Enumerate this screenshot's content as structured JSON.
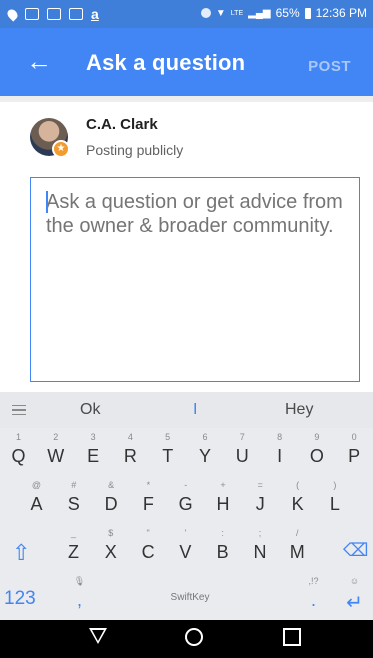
{
  "status_bar": {
    "left_icons": [
      "location-icon",
      "keyboard-icon",
      "image-icon",
      "mail-icon",
      "amazon-icon"
    ],
    "right_icons": [
      "bluetooth-icon",
      "wifi-icon",
      "lte-icon",
      "signal-icon"
    ],
    "network_label": "LTE",
    "battery": "65%",
    "time": "12:36 PM"
  },
  "app_bar": {
    "back_icon": "arrow-left-icon",
    "title": "Ask a question",
    "post_label": "POST"
  },
  "user": {
    "name": "C.A. Clark",
    "visibility": "Posting publicly",
    "badge_icon": "star-badge-icon"
  },
  "question": {
    "placeholder": "Ask a question or get advice from the owner & broader community.",
    "value": ""
  },
  "keyboard": {
    "suggestions": [
      "Ok",
      "I",
      "Hey"
    ],
    "row1": [
      {
        "h": "1",
        "m": "Q"
      },
      {
        "h": "2",
        "m": "W"
      },
      {
        "h": "3",
        "m": "E"
      },
      {
        "h": "4",
        "m": "R"
      },
      {
        "h": "5",
        "m": "T"
      },
      {
        "h": "6",
        "m": "Y"
      },
      {
        "h": "7",
        "m": "U"
      },
      {
        "h": "8",
        "m": "I"
      },
      {
        "h": "9",
        "m": "O"
      },
      {
        "h": "0",
        "m": "P"
      }
    ],
    "row2": [
      {
        "h": "@",
        "m": "A"
      },
      {
        "h": "#",
        "m": "S"
      },
      {
        "h": "&",
        "m": "D"
      },
      {
        "h": "*",
        "m": "F"
      },
      {
        "h": "-",
        "m": "G"
      },
      {
        "h": "+",
        "m": "H"
      },
      {
        "h": "=",
        "m": "J"
      },
      {
        "h": "(",
        "m": "K"
      },
      {
        "h": ")",
        "m": "L"
      }
    ],
    "row3": [
      {
        "h": "_",
        "m": "Z"
      },
      {
        "h": "$",
        "m": "X"
      },
      {
        "h": "\"",
        "m": "C"
      },
      {
        "h": "'",
        "m": "V"
      },
      {
        "h": ":",
        "m": "B"
      },
      {
        "h": ";",
        "m": "N"
      },
      {
        "h": "/",
        "m": "M"
      }
    ],
    "numbers_key": "123",
    "comma_key": ",",
    "comma_hint": "🎙",
    "space_label": "SwiftKey",
    "period_key": ".",
    "period_hint": ",!?",
    "enter_hint": "☺",
    "accent_color": "#4285f4"
  },
  "nav_bar": {
    "back_icon": "back-triangle-icon",
    "home_icon": "home-circle-icon",
    "recents_icon": "recents-square-icon"
  }
}
